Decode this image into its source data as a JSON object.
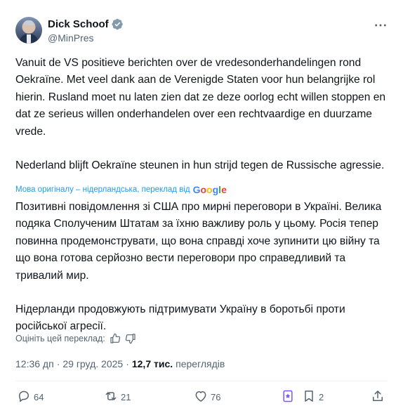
{
  "author": {
    "name": "Dick Schoof",
    "handle": "@MinPres"
  },
  "tweet": {
    "paragraph1": "Vanuit de VS positieve berichten over de vredesonderhandelingen rond Oekraïne. Met veel dank aan de Verenigde Staten voor hun belangrijke rol hierin. Rusland moet nu laten zien dat ze deze oorlog echt willen stoppen en dat ze serieus willen onderhandelen over een rechtvaardige en duurzame vrede.",
    "paragraph2": "Nederland blijft Oekraïne steunen in hun strijd tegen de Russische agressie."
  },
  "translation": {
    "note": "Мова оригіналу – нідерландська, переклад від",
    "provider": "Google",
    "paragraph1": "Позитивні повідомлення зі США про мирні переговори в Україні. Велика подяка Сполученим Штатам за їхню важливу роль у цьому. Росія тепер повинна продемонструвати, що вона справді хоче зупинити цю війну та що вона готова серйозно вести переговори про справедливий та тривалий мир.",
    "paragraph2": "Нідерланди продовжують підтримувати Україну в боротьбі проти російської агресії.",
    "rate_label": "Оцініть цей переклад:"
  },
  "meta": {
    "time": "12:36 дп",
    "date": "29 груд. 2025",
    "views_count": "12,7 тис.",
    "views_label": "переглядів"
  },
  "actions": {
    "replies": "64",
    "reposts": "21",
    "likes": "76",
    "bookmarks": "2"
  },
  "colors": {
    "accent": "#1d9bf0",
    "text": "#0f1419",
    "secondary": "#536471",
    "premium": "#7856ff"
  },
  "icons": [
    "verified-badge-icon",
    "more-icon",
    "thumbs-up-icon",
    "thumbs-down-icon",
    "reply-icon",
    "repost-icon",
    "like-icon",
    "views-icon",
    "premium-icon",
    "bookmark-icon",
    "share-icon"
  ]
}
